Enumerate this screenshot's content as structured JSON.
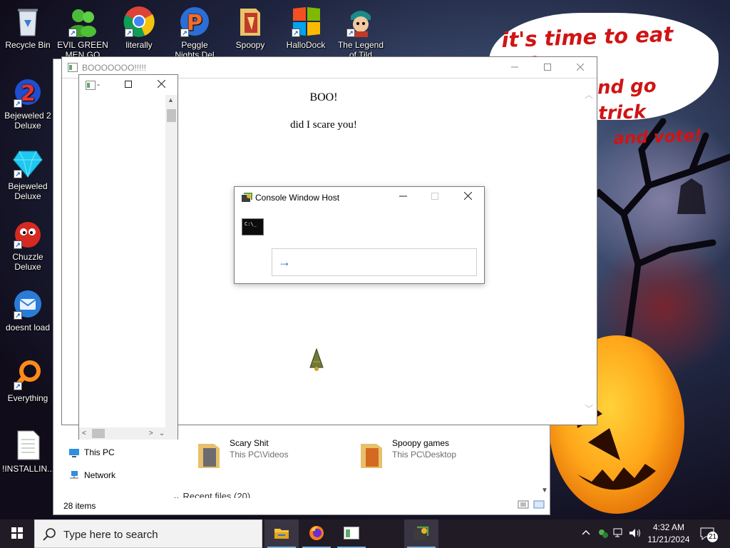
{
  "wallpaper": {
    "speech_lines": [
      "it's time to eat shit",
      "nd go trick",
      "and vote!"
    ],
    "text_color": "#d01414"
  },
  "desktop_icons": [
    {
      "label": "Recycle Bin",
      "icon": "recycle-bin-icon"
    },
    {
      "label": "EVIL GREEN MEN GO",
      "icon": "evil-green-men-icon"
    },
    {
      "label": "literally",
      "icon": "chrome-icon"
    },
    {
      "label": "Peggle Nights Del",
      "icon": "peggle-icon"
    },
    {
      "label": "Spoopy",
      "icon": "spoopy-folder-icon"
    },
    {
      "label": "HalloDock",
      "icon": "hallodock-icon"
    },
    {
      "label": "The Legend of Tild",
      "icon": "legend-game-icon"
    },
    {
      "label": "Bejeweled 2 Deluxe",
      "icon": "bejeweled-2-icon"
    },
    {
      "label": "Bejeweled Deluxe",
      "icon": "bejeweled-icon"
    },
    {
      "label": "Chuzzle Deluxe",
      "icon": "chuzzle-icon"
    },
    {
      "label": "doesnt load",
      "icon": "thunderbird-icon"
    },
    {
      "label": "Everything",
      "icon": "everything-search-icon"
    },
    {
      "label": "!INSTALLIN...",
      "icon": "text-file-icon"
    }
  ],
  "explorer": {
    "nav": [
      "This PC",
      "Network"
    ],
    "quick_access": [
      {
        "name": "Scary Shit",
        "path": "This PC\\Videos"
      },
      {
        "name": "Spoopy games",
        "path": "This PC\\Desktop"
      }
    ],
    "recent_files": "Recent files (20)",
    "status": "28 items"
  },
  "boo_window": {
    "title": "BOOOOOOO!!!!!",
    "heading": "BOO!",
    "message": "did I scare you!"
  },
  "small_window": {
    "title": "-"
  },
  "console_dialog": {
    "title": "Console Window Host",
    "icon_text": "C:\\_"
  },
  "taskbar": {
    "search_placeholder": "Type here to search",
    "apps": [
      "file-explorer-icon",
      "firefox-icon",
      "app-window-icon",
      "console-host-icon"
    ],
    "time": "4:32 AM",
    "date": "11/21/2024",
    "notification_count": "21"
  }
}
